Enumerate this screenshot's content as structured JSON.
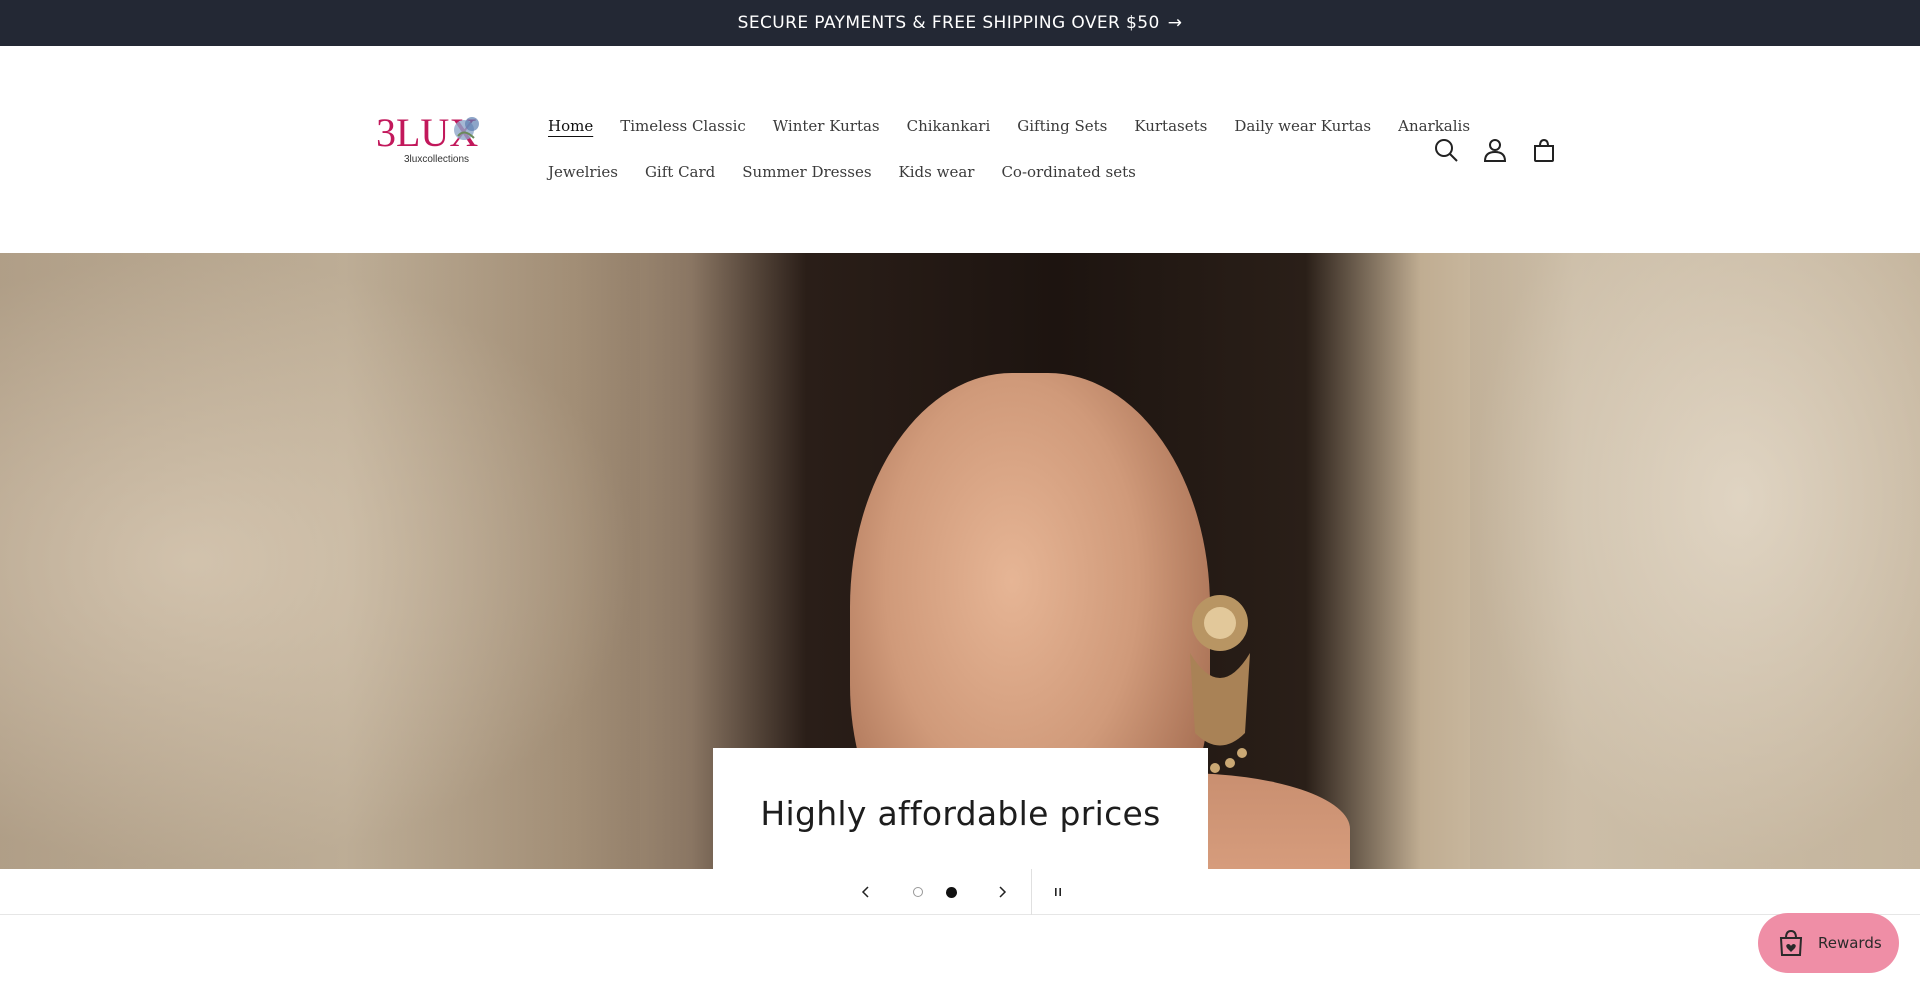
{
  "announcement": {
    "text": "SECURE PAYMENTS & FREE SHIPPING OVER $50",
    "arrow": "→"
  },
  "logo": {
    "mark": "3LUX",
    "subtitle": "3luxcollections",
    "brand_color": "#c2185b"
  },
  "nav": {
    "row1": [
      "Home",
      "Timeless Classic",
      "Winter Kurtas",
      "Chikankari",
      "Gifting Sets",
      "Kurtasets",
      "Daily wear Kurtas",
      "Anarkalis"
    ],
    "row2": [
      "Jewelries",
      "Gift Card",
      "Summer Dresses",
      "Kids wear",
      "Co-ordinated sets"
    ],
    "active": "Home"
  },
  "header_icons": [
    "search-icon",
    "account-icon",
    "cart-icon"
  ],
  "hero": {
    "caption": "Highly affordable prices"
  },
  "slider": {
    "slide_count": 2,
    "current_slide": 2,
    "prev_icon": "chevron-left-icon",
    "next_icon": "chevron-right-icon",
    "pause_icon": "pause-icon"
  },
  "rewards": {
    "label": "Rewards",
    "color": "#ef8ea6"
  },
  "colors": {
    "announcement_bg": "#232834",
    "text": "#3b3b3b"
  }
}
